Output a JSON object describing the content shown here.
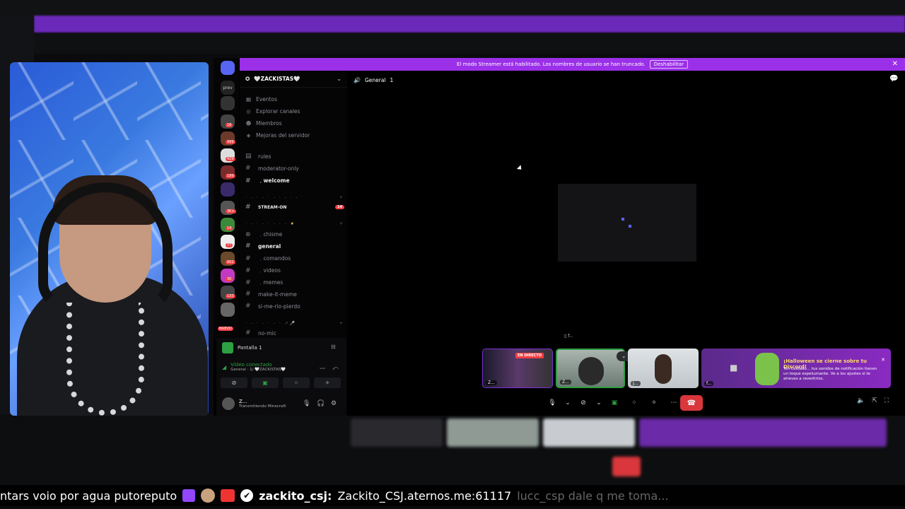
{
  "streamer_banner": {
    "text": "El modo Streamer está habilitado. Los nombres de usuario se han truncado.",
    "button": "Deshabilitar"
  },
  "server": {
    "name": "🤍ZACKISTAS🤍"
  },
  "nav": [
    {
      "label": "Eventos",
      "icon": "calendar-icon"
    },
    {
      "label": "Explorar canales",
      "icon": "compass-icon"
    },
    {
      "label": "Miembros",
      "icon": "members-icon"
    },
    {
      "label": "Mejoras del servidor",
      "icon": "boost-icon"
    }
  ],
  "channels": {
    "rules": "rules",
    "moderator_only": "moderator-only",
    "welcome": "﹒welcome",
    "stream_on": "STREAM-ON",
    "stream_on_badge": "14",
    "chisme": "﹒chisme",
    "general": "general",
    "comandos": "﹒comandos",
    "videos": "﹒videos",
    "memes": "﹒memes",
    "make_it_meme": "make-it-meme",
    "si_me_rio": "si-me-rio-pierdo",
    "no_mic": "no-mic"
  },
  "voice": {
    "screen_label": "Pantalla 1",
    "status": "Vídeo conectado",
    "channel": "General · 1/ 🤍ZACKISTAS🤍",
    "user": "Z...",
    "activity": "Transmitiendo Minecraft"
  },
  "main": {
    "channel_title": "General",
    "count": "1",
    "small_label": "f..."
  },
  "tiles": [
    {
      "label": "Z...",
      "badge": "EN DIRECTO"
    },
    {
      "label": "Z..."
    },
    {
      "label": "J..."
    },
    {
      "label": "f..."
    }
  ],
  "halloween": {
    "title": "¡Halloween se cierne sobre tu Discord!",
    "text": "Ten cuidado... tus sonidos de notificación tienen un toque espeluznante. Ve a los ajustes si te atreves a revertirlos."
  },
  "rail_badges": [
    "16",
    "999",
    "429",
    "199",
    "3K+",
    "14",
    "77",
    "602",
    "30",
    "133",
    "NUEVO"
  ],
  "ticker": {
    "left_text": "ntars voio por agua putoreputo",
    "user": "zackito_csj:",
    "message": "Zackito_CSJ.aternos.me:61117",
    "ghost": "lucc_csp dale q me toma..."
  },
  "colors": {
    "brand": "#5865f2",
    "streamer": "#9b30e8",
    "hangup": "#da373c",
    "live": "#f23f43"
  }
}
